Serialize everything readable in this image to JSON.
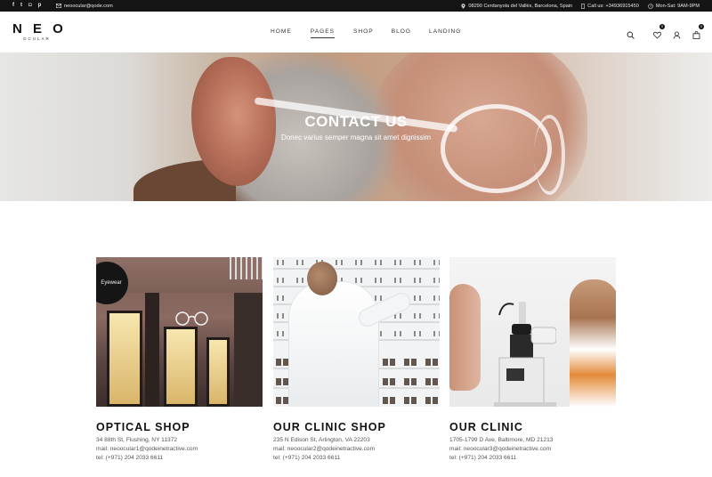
{
  "topbar": {
    "social": [
      {
        "icon": "facebook-icon",
        "glyph": "f"
      },
      {
        "icon": "twitter-icon",
        "glyph": "t"
      },
      {
        "icon": "instagram-icon",
        "glyph": "◘"
      },
      {
        "icon": "pinterest-icon",
        "glyph": "p"
      }
    ],
    "email": "neoocular@qode.com",
    "address": "08290 Cerdanyola del Vallès, Barcelona, Spain",
    "phone": "Call us: +34936915450",
    "hours": "Mon-Sat: 9AM-9PM"
  },
  "header": {
    "logo": "N E O",
    "logo_sub": "OCULAR",
    "nav": [
      {
        "label": "HOME",
        "active": false
      },
      {
        "label": "PAGES",
        "active": true
      },
      {
        "label": "SHOP",
        "active": false
      },
      {
        "label": "BLOG",
        "active": false
      },
      {
        "label": "LANDING",
        "active": false
      }
    ],
    "wishlist_count": "0",
    "cart_count": "0"
  },
  "hero": {
    "title": "CONTACT US",
    "subtitle": "Donec varius semper magna sit amet dignissim"
  },
  "cards": [
    {
      "name": "OPTICAL SHOP",
      "address": "34 88th St, Flushing, NY 11372",
      "mail": "mail: neoocular1@qodeinetractive.com",
      "tel": "tel: (+971) 204 2033 6611",
      "image_badge": "Eyewear"
    },
    {
      "name": "OUR CLINIC SHOP",
      "address": "235 N Edison St, Arlington, VA 22203",
      "mail": "mail: neoocular2@qodeinetractive.com",
      "tel": "tel: (+971) 204 2033 6611"
    },
    {
      "name": "OUR CLINIC",
      "address": "1705-1799 D Ave, Baltimore, MD 21213",
      "mail": "mail: neoocular3@qodeinetractive.com",
      "tel": "tel: (+971) 204 2033 6611"
    }
  ]
}
